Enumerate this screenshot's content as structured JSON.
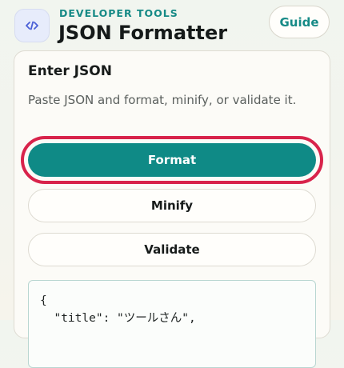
{
  "header": {
    "logo_icon": "code-brackets-icon",
    "kicker": "DEVELOPER TOOLS",
    "title": "JSON Formatter",
    "guide_label": "Guide"
  },
  "card": {
    "title": "Enter JSON",
    "description": "Paste JSON and format, minify, or validate it.",
    "buttons": {
      "format": "Format",
      "minify": "Minify",
      "validate": "Validate"
    },
    "input_value": "{\n  \"title\": \"ツールさん\","
  },
  "colors": {
    "accent": "#0f8a86",
    "focus_ring": "#d8234b",
    "logo_bg": "#e7ecfb",
    "logo_icon": "#4a5fd6"
  }
}
